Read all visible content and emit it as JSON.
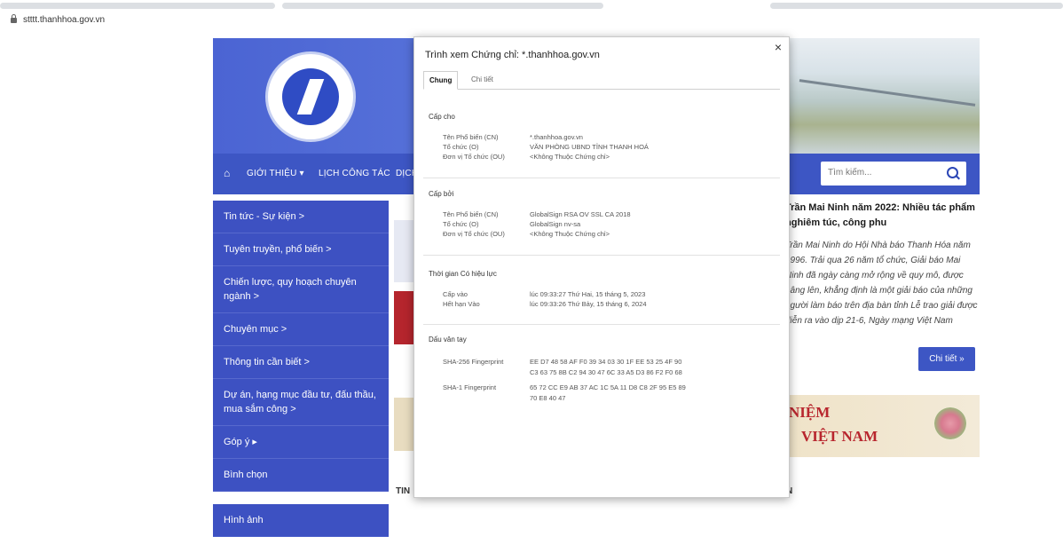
{
  "browser": {
    "url": "stttt.thanhhoa.gov.vn"
  },
  "nav": {
    "items": [
      "GIỚI THIỆU ▾",
      "LỊCH CÔNG TÁC",
      "DỊCH"
    ],
    "search_placeholder": "Tìm kiếm..."
  },
  "sidebar": {
    "items": [
      "Tin tức - Sự kiện >",
      "Tuyên truyền, phổ biến >",
      "Chiến lược, quy hoạch chuyên ngành >",
      "Chuyên mục >",
      "Thông tin cần biết >",
      "Dự án, hạng mục đầu tư, đấu thầu, mua sắm công >",
      "Góp ý ▸",
      "Bình chọn",
      "Hình ảnh"
    ]
  },
  "news": {
    "title": "Trần Mai Ninh năm 2022: Nhiều tác phẩm nghiêm túc, công phu",
    "body": "Trần Mai Ninh do Hội Nhà báo Thanh Hóa năm 1996. Trải qua 26 năm tổ chức, Giải báo Mai Ninh đã ngày càng mở rộng về quy mô, được nâng lên, khẳng định là một giải báo của những người làm báo trên địa bàn tỉnh Lễ trao giải được diễn ra vào dịp 21-6, Ngày mạng Việt Nam",
    "button": "Chi tiết »"
  },
  "announcement": {
    "line1": "NIỆM",
    "line2": "VIỆT NAM"
  },
  "section_labels": {
    "left": "TIN",
    "right": "N"
  },
  "certificate": {
    "title": "Trình xem Chứng chỉ: *.thanhhoa.gov.vn",
    "close": "×",
    "tabs": [
      "Chung",
      "Chi tiết"
    ],
    "issued_to": {
      "heading": "Cấp cho",
      "rows": [
        {
          "k": "Tên Phổ biến (CN)",
          "v": "*.thanhhoa.gov.vn"
        },
        {
          "k": "Tổ chức (O)",
          "v": "VĂN PHÒNG UBND TỈNH THANH HOÁ"
        },
        {
          "k": "Đơn vị Tổ chức (OU)",
          "v": "<Không Thuộc Chứng chỉ>"
        }
      ]
    },
    "issued_by": {
      "heading": "Cấp bởi",
      "rows": [
        {
          "k": "Tên Phổ biến (CN)",
          "v": "GlobalSign RSA OV SSL CA 2018"
        },
        {
          "k": "Tổ chức (O)",
          "v": "GlobalSign nv-sa"
        },
        {
          "k": "Đơn vị Tổ chức (OU)",
          "v": "<Không Thuộc Chứng chỉ>"
        }
      ]
    },
    "validity": {
      "heading": "Thời gian Có hiệu lực",
      "rows": [
        {
          "k": "Cấp vào",
          "v": "lúc 09:33:27 Thứ Hai, 15 tháng 5, 2023"
        },
        {
          "k": "Hết hạn Vào",
          "v": "lúc 09:33:26 Thứ Bảy, 15 tháng 6, 2024"
        }
      ]
    },
    "fingerprints": {
      "heading": "Dấu vân tay",
      "sha256_label": "SHA-256 Fingerprint",
      "sha256_line1": "EE D7 48 58 AF F0 39 34 03 30 1F EE 53 25 4F 90",
      "sha256_line2": "C3 63 75 8B C2 94 30 47 6C 33 A5 D3 86 F2 F0 68",
      "sha1_label": "SHA-1 Fingerprint",
      "sha1_line1": "65 72 CC E9 AB 37 AC 1C 5A 11 D8 C8 2F 95 E5 89",
      "sha1_line2": "70 E8 40 47"
    }
  }
}
